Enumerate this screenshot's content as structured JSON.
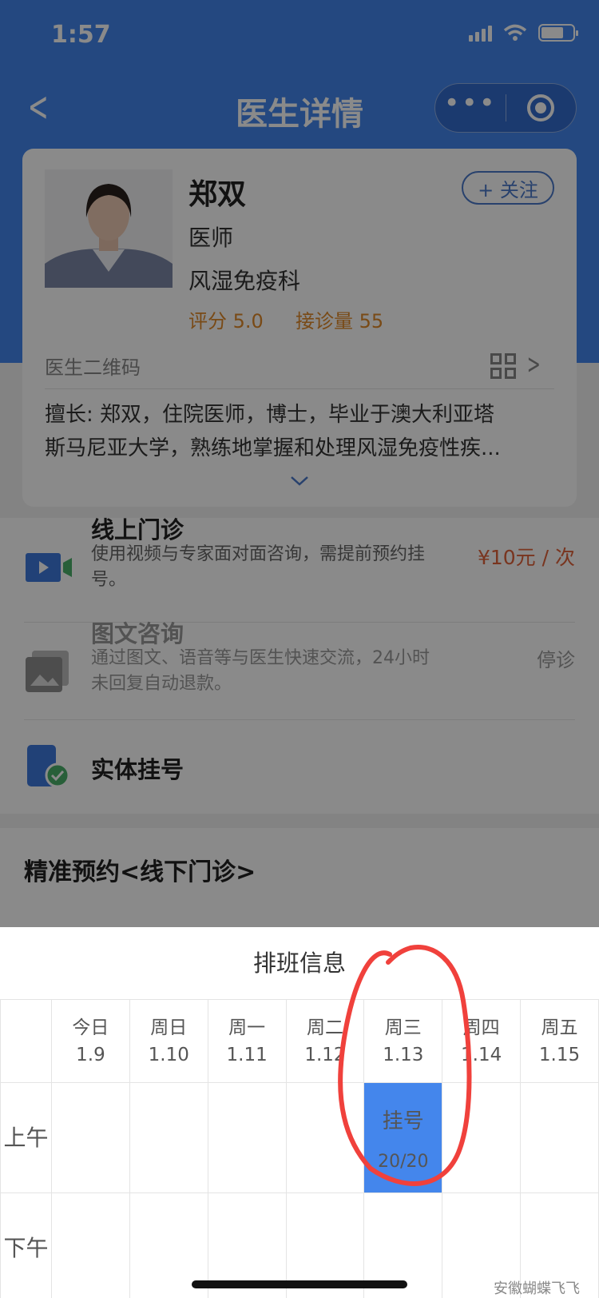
{
  "status_bar": {
    "time": "1:57"
  },
  "nav": {
    "title": "医生详情",
    "back_icon": "chevron-left-icon"
  },
  "doctor": {
    "name": "郑双",
    "follow_label": "+ 关注",
    "title": "医师",
    "department": "风湿免疫科",
    "rating": "评分 5.0",
    "visits": "接诊量 55",
    "qr_label": "医生二维码",
    "expertise_line1": "擅长: 郑双，住院医师，博士，毕业于澳大利亚塔",
    "expertise_line2": "斯马尼亚大学，熟练地掌握和处理风湿免疫性疾..."
  },
  "services": [
    {
      "title": "线上门诊",
      "desc": "使用视频与专家面对面咨询，需提前预约挂号。",
      "right": "¥10元 / 次",
      "icon": "video-icon"
    },
    {
      "title": "图文咨询",
      "desc": "通过图文、语音等与医生快速交流，24小时未回复自动退款。",
      "right": "停诊",
      "icon": "image-text-icon"
    },
    {
      "title": "实体挂号",
      "icon": "phone-check-icon"
    }
  ],
  "precise_booking": {
    "title": "精准预约<线下门诊>"
  },
  "schedule": {
    "title": "排班信息",
    "days": [
      {
        "name": "今日",
        "date": "1.9"
      },
      {
        "name": "周日",
        "date": "1.10"
      },
      {
        "name": "周一",
        "date": "1.11"
      },
      {
        "name": "周二",
        "date": "1.12"
      },
      {
        "name": "周三",
        "date": "1.13"
      },
      {
        "name": "周四",
        "date": "1.14"
      },
      {
        "name": "周五",
        "date": "1.15"
      }
    ],
    "morning_label": "上午",
    "afternoon_label": "下午",
    "slot": {
      "label": "挂号",
      "count": "20/20"
    }
  },
  "watermark": "安徽蝴蝶飞飞",
  "colors": {
    "primary": "#4486ec",
    "orange": "#e08a2a",
    "price": "#e0623a",
    "annotation": "#f0413c"
  }
}
